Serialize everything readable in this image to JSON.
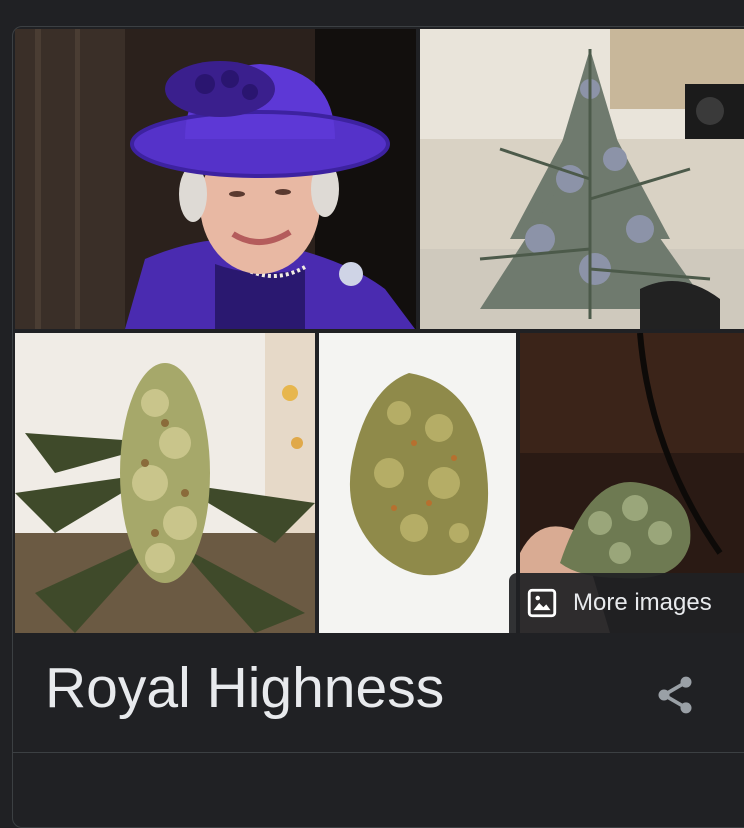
{
  "panel": {
    "title": "Royal Highness",
    "more_images_label": "More images",
    "share_icon": "share-icon",
    "more_images_icon": "image-icon"
  },
  "images": [
    {
      "subject": "woman in purple hat"
    },
    {
      "subject": "cannabis plant indoors"
    },
    {
      "subject": "cannabis plant bud"
    },
    {
      "subject": "dried cannabis bud"
    },
    {
      "subject": "cannabis bud in hand"
    }
  ],
  "colors": {
    "background": "#202124",
    "text": "#e8eaed",
    "icon": "#9aa0a6",
    "divider": "#3c4043"
  }
}
